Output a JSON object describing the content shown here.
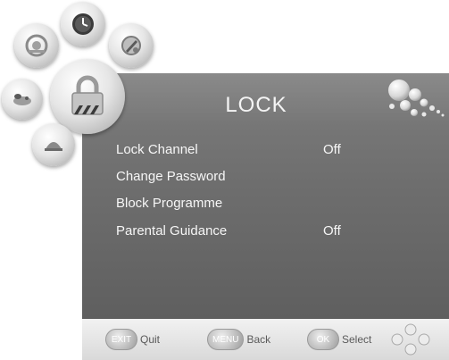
{
  "menu": {
    "title": "LOCK",
    "items": [
      {
        "label": "Lock Channel",
        "value": "Off"
      },
      {
        "label": "Change Password",
        "value": ""
      },
      {
        "label": "Block Programme",
        "value": ""
      },
      {
        "label": "Parental Guidance",
        "value": "Off"
      }
    ]
  },
  "hints": [
    {
      "key": "EXIT",
      "label": "Quit"
    },
    {
      "key": "MENU",
      "label": "Back"
    },
    {
      "key": "OK",
      "label": "Select"
    }
  ],
  "icons": {
    "clock": "clock-icon",
    "picture": "picture-icon",
    "setup": "setup-icon",
    "lock": "lock-icon",
    "sound": "sound-icon",
    "channel": "channel-icon",
    "dpad": "dpad-icon",
    "decoration": "bubbles-decoration-icon"
  },
  "colors": {
    "panel": "#707070",
    "text": "#f6f6f6",
    "bottombar": "#e4e4e4",
    "hint_text": "#5a5a5a"
  }
}
